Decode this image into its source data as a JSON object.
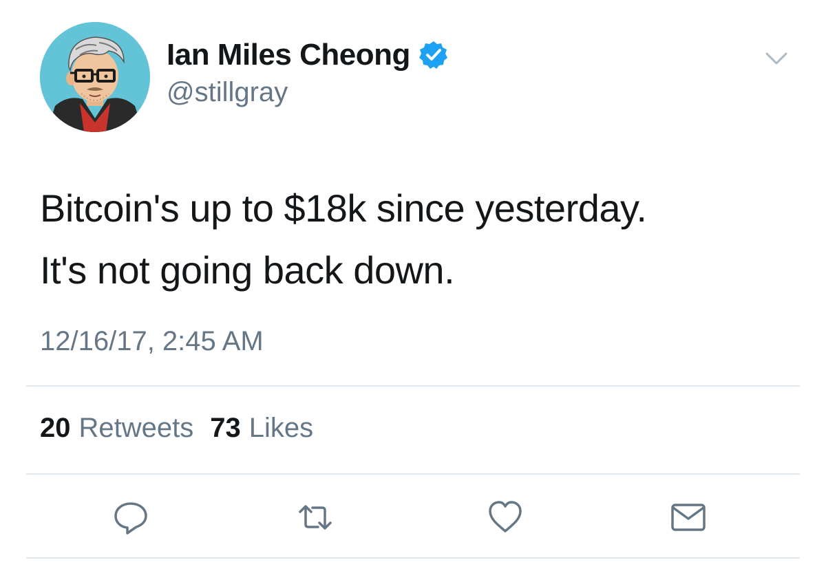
{
  "tweet": {
    "display_name": "Ian Miles Cheong",
    "handle": "@stillgray",
    "verified": true,
    "text_lines": [
      "Bitcoin's up to $18k since yesterday.",
      "It's not going back down."
    ],
    "timestamp": "12/16/17, 2:45 AM",
    "stats": {
      "retweets_count": "20",
      "retweets_label": "Retweets",
      "likes_count": "73",
      "likes_label": "Likes"
    }
  },
  "icons": {
    "avatar": "avatar-illustration",
    "verified": "verified-badge-icon",
    "caret": "chevron-down-icon",
    "reply": "reply-icon",
    "retweet": "retweet-icon",
    "like": "heart-icon",
    "dm": "envelope-icon"
  },
  "colors": {
    "text_primary": "#14171a",
    "text_secondary": "#657786",
    "verified_blue": "#1da1f2",
    "divider": "#e1e8ed",
    "avatar_bg": "#62c4d6"
  }
}
